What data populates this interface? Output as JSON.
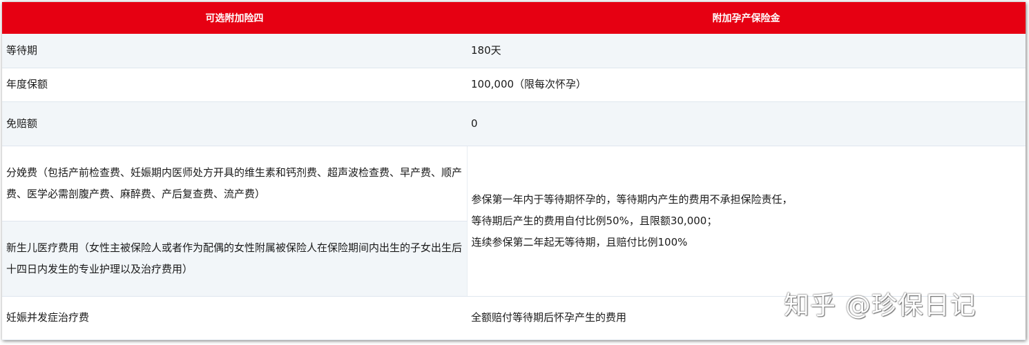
{
  "table": {
    "headers": [
      "可选附加险四",
      "附加孕产保险金"
    ],
    "rows": [
      {
        "label": "等待期",
        "value": "180天"
      },
      {
        "label": "年度保额",
        "value": "100,000（限每次怀孕）"
      },
      {
        "label": "免赔额",
        "value": "0"
      },
      {
        "label": "分娩费（包括产前检查费、妊娠期内医师处方开具的维生素和钙剂费、超声波检查费、早产费、顺产费、医学必需剖腹产费、麻醉费、产后复查费、流产费）"
      },
      {
        "label": "新生儿医疗费用（女性主被保险人或者作为配偶的女性附属被保险人在保险期间内出生的子女出生后十四日内发生的专业护理以及治疗费用）"
      },
      {
        "label": "妊娠并发症治疗费",
        "value": "全额赔付等待期后怀孕产生的费用"
      }
    ],
    "merged_value_lines": [
      "参保第一年内于等待期怀孕的，等待期内产生的费用不承担保险责任，",
      "等待期后产生的费用自付比例50%，且限额30,000；",
      "连续参保第二年起无等待期，且赔付比例100%"
    ]
  },
  "watermark": "知乎 @珍保日记",
  "colors": {
    "header_bg": "#e60012",
    "header_text": "#ffffff",
    "row_shade": "#f2f6f9",
    "border": "#dfe6ee"
  }
}
